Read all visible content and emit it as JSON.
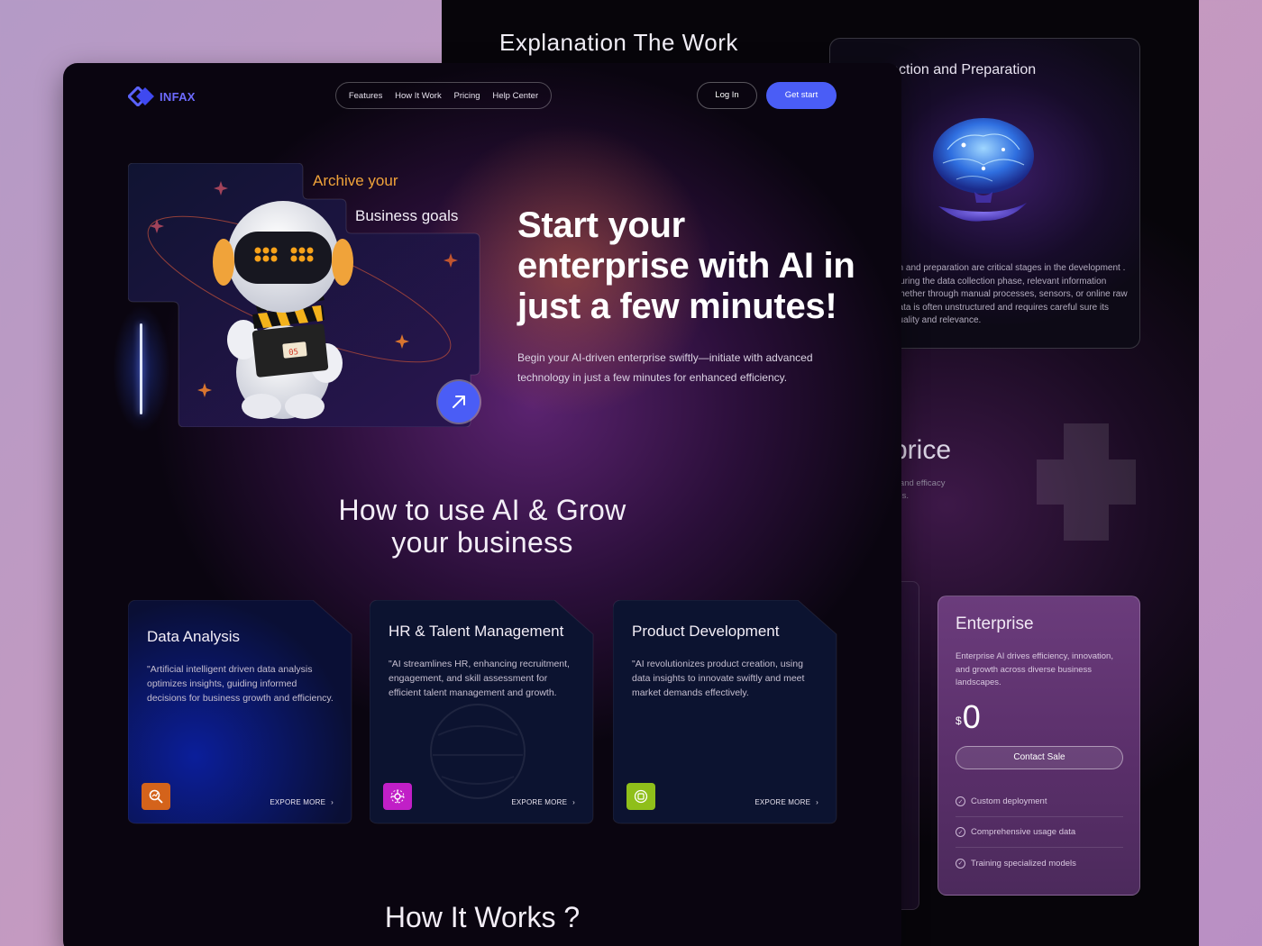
{
  "back_page": {
    "section_title": "Explanation The Work",
    "collection_card": {
      "title": "llection and Preparation",
      "text": "on and preparation are critical stages in the development . During the data collection phase, relevant information whether through manual processes, sensors, or online raw data is often unstructured and requires careful sure its quality and relevance."
    },
    "price_heading": "price",
    "price_sub_line1": "e and efficacy",
    "price_sub_line2": "eds.",
    "enterprise": {
      "name": "Enterprise",
      "description": "Enterprise AI drives efficiency, innovation, and growth across diverse business landscapes.",
      "currency": "$",
      "price": "0",
      "cta": "Contact Sale",
      "features": [
        "Custom deployment",
        "Comprehensive usage data",
        "Training specialized models"
      ]
    }
  },
  "header": {
    "logo_text": "INFAX",
    "nav": [
      "Features",
      "How It Work",
      "Pricing",
      "Help Center"
    ],
    "login": "Log In",
    "get_start": "Get start"
  },
  "hero": {
    "tag_line1": "Archive your",
    "tag_line2": "Business goals",
    "robot_display": "05",
    "title": "Start your enterprise with AI in just a few minutes!",
    "subtitle": "Begin your AI-driven enterprise swiftly—initiate with advanced technology in just a few minutes for enhanced efficiency."
  },
  "how_to_use": {
    "title": "How to use AI & Grow your business",
    "cards": [
      {
        "title": "Data Analysis",
        "description": "\"Artificial intelligent driven data analysis optimizes insights, guiding informed decisions for business growth and efficiency.",
        "link": "EXPORE MORE",
        "icon": "search-chart-icon",
        "icon_color": "#d4631b"
      },
      {
        "title": "HR & Talent Management",
        "description": "\"AI streamlines HR, enhancing recruitment, engagement, and skill assessment for efficient talent management and growth.",
        "link": "EXPORE MORE",
        "icon": "network-icon",
        "icon_color": "#c11fc7"
      },
      {
        "title": "Product Development",
        "description": "\"AI revolutionizes product creation, using data insights to innovate swiftly and meet market demands effectively.",
        "link": "EXPORE MORE",
        "icon": "product-icon",
        "icon_color": "#8fbf1a"
      }
    ]
  },
  "how_it_works": {
    "title": "How It Works ?"
  },
  "colors": {
    "accent": "#4a5df6",
    "orange": "#f0a33a"
  }
}
